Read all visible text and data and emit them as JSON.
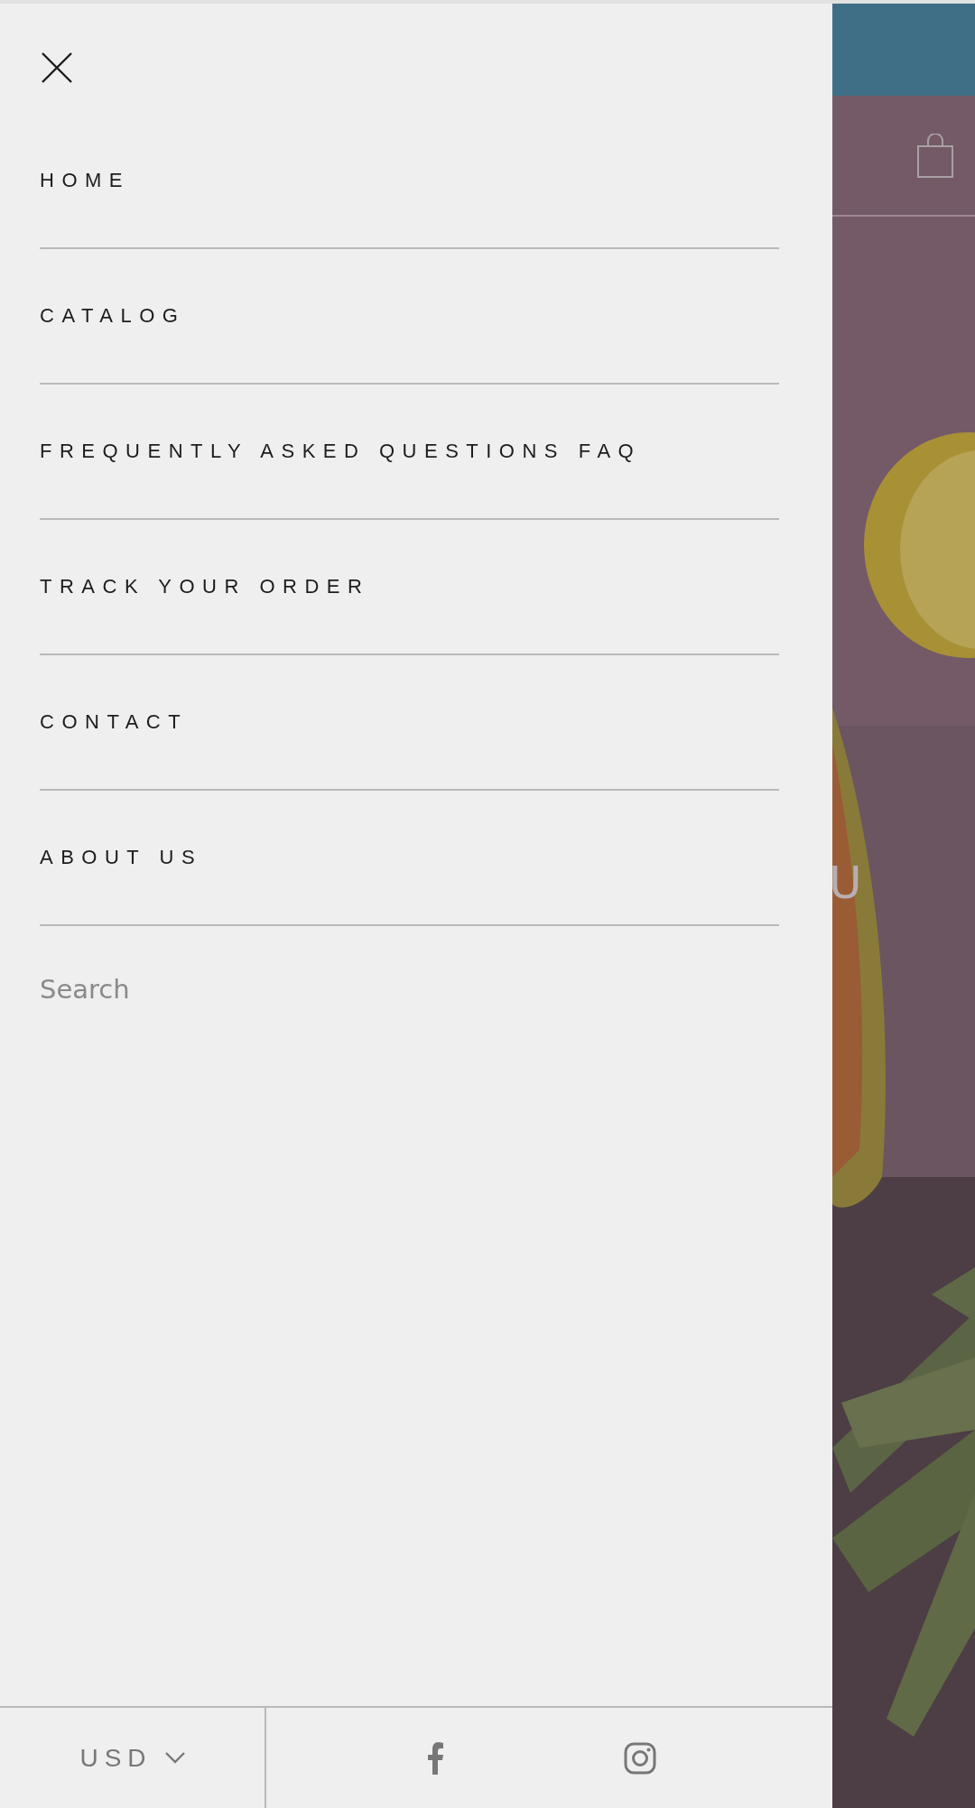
{
  "menu": {
    "items": [
      {
        "label": "HOME"
      },
      {
        "label": "CATALOG"
      },
      {
        "label": "FREQUENTLY ASKED QUESTIONS FAQ"
      },
      {
        "label": "TRACK YOUR ORDER"
      },
      {
        "label": "CONTACT"
      },
      {
        "label": "ABOUT US"
      }
    ]
  },
  "search": {
    "placeholder": "Search"
  },
  "footer": {
    "currency": "USD"
  },
  "background_page": {
    "hero_text": "U"
  }
}
